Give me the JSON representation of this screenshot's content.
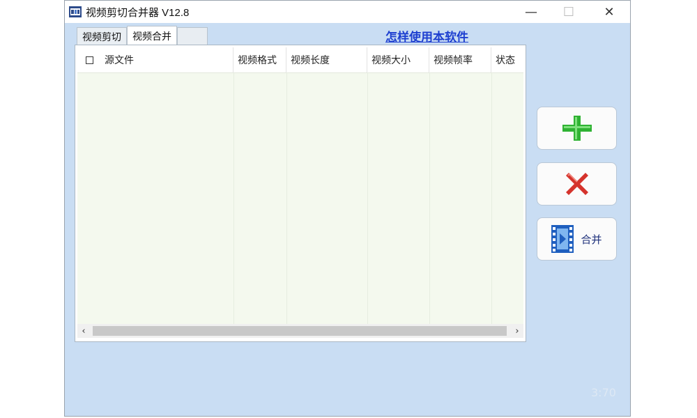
{
  "window": {
    "title": "视频剪切合并器 V12.8",
    "controls": {
      "minimize": "—",
      "maximize": "☐",
      "close": "✕"
    }
  },
  "tabs": [
    {
      "label": "视频剪切",
      "active": false
    },
    {
      "label": "视频合并",
      "active": true
    }
  ],
  "help_link": "怎样使用本软件",
  "table": {
    "columns": [
      "源文件",
      "视频格式",
      "视频长度",
      "视频大小",
      "视频帧率",
      "状态"
    ],
    "rows": []
  },
  "scrollbar": {
    "left_arrow": "‹",
    "right_arrow": "›"
  },
  "buttons": {
    "add": {
      "icon": "plus-icon",
      "color": "#2fb233"
    },
    "delete": {
      "icon": "cross-icon",
      "color": "#d5332c"
    },
    "merge": {
      "icon": "film-icon",
      "label": "合并",
      "color": "#1f5fbf"
    }
  },
  "watermark": "3:70",
  "colors": {
    "window_bg": "#c9ddf3",
    "table_bg": "#f4f9ee",
    "link": "#1d3fd0"
  }
}
